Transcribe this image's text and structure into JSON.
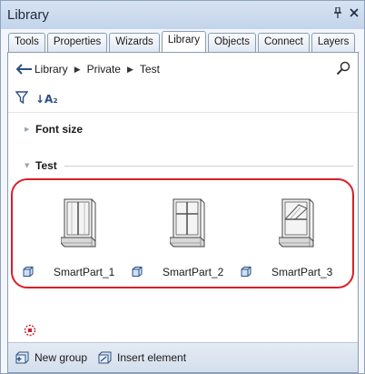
{
  "window": {
    "title": "Library",
    "pin_glyph": "☂",
    "close_glyph": "✕"
  },
  "tabs": [
    {
      "label": "Tools",
      "active": false
    },
    {
      "label": "Properties",
      "active": false
    },
    {
      "label": "Wizards",
      "active": false
    },
    {
      "label": "Library",
      "active": true
    },
    {
      "label": "Objects",
      "active": false
    },
    {
      "label": "Connect",
      "active": false
    },
    {
      "label": "Layers",
      "active": false
    }
  ],
  "breadcrumb": {
    "items": [
      "Library",
      "Private",
      "Test"
    ],
    "separator": "▶"
  },
  "toolbar": {
    "sort_label": "↓A₂"
  },
  "groups": [
    {
      "label": "Font size",
      "expanded": false
    },
    {
      "label": "Test",
      "expanded": true
    }
  ],
  "items": [
    {
      "label": "SmartPart_1",
      "icon": "window-sash-icon"
    },
    {
      "label": "SmartPart_2",
      "icon": "window-cross-icon"
    },
    {
      "label": "SmartPart_3",
      "icon": "window-open-icon"
    }
  ],
  "footer": {
    "new_group": "New group",
    "insert_element": "Insert element"
  },
  "colors": {
    "highlight": "#d81f26",
    "accent": "#2c4f83"
  }
}
